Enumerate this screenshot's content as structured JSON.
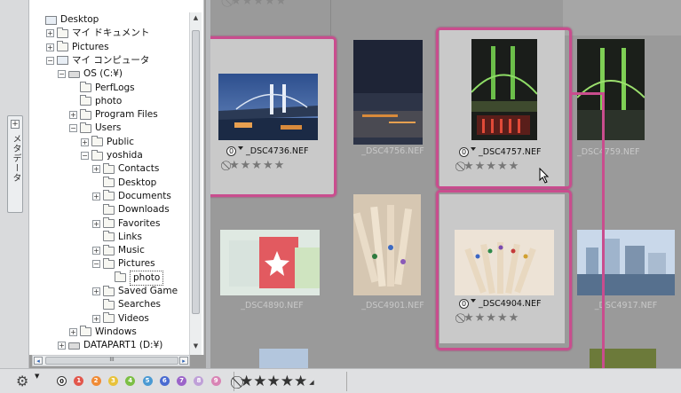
{
  "sidebar_tab": {
    "plus": "+",
    "label": "メタデータ"
  },
  "tree": {
    "expander_plus": "+",
    "expander_minus": "−",
    "items": [
      {
        "label": "Desktop",
        "indent": 0,
        "icon": "pc",
        "exp": ""
      },
      {
        "label": "マイ ドキュメント",
        "indent": 1,
        "icon": "folder",
        "exp": "+"
      },
      {
        "label": "Pictures",
        "indent": 1,
        "icon": "folder",
        "exp": "+"
      },
      {
        "label": "マイ コンピュータ",
        "indent": 1,
        "icon": "pc",
        "exp": "−"
      },
      {
        "label": "OS (C:¥)",
        "indent": 2,
        "icon": "drive",
        "exp": "−"
      },
      {
        "label": "PerfLogs",
        "indent": 3,
        "icon": "folder",
        "exp": ""
      },
      {
        "label": "photo",
        "indent": 3,
        "icon": "folder",
        "exp": ""
      },
      {
        "label": "Program Files",
        "indent": 3,
        "icon": "folder",
        "exp": "+"
      },
      {
        "label": "Users",
        "indent": 3,
        "icon": "folder",
        "exp": "−"
      },
      {
        "label": "Public",
        "indent": 4,
        "icon": "folder",
        "exp": "+"
      },
      {
        "label": "yoshida",
        "indent": 4,
        "icon": "folder",
        "exp": "−"
      },
      {
        "label": "Contacts",
        "indent": 5,
        "icon": "folder",
        "exp": "+"
      },
      {
        "label": "Desktop",
        "indent": 5,
        "icon": "folder",
        "exp": ""
      },
      {
        "label": "Documents",
        "indent": 5,
        "icon": "folder",
        "exp": "+"
      },
      {
        "label": "Downloads",
        "indent": 5,
        "icon": "folder",
        "exp": ""
      },
      {
        "label": "Favorites",
        "indent": 5,
        "icon": "folder",
        "exp": "+"
      },
      {
        "label": "Links",
        "indent": 5,
        "icon": "folder",
        "exp": ""
      },
      {
        "label": "Music",
        "indent": 5,
        "icon": "folder",
        "exp": "+"
      },
      {
        "label": "Pictures",
        "indent": 5,
        "icon": "folder",
        "exp": "−"
      },
      {
        "label": "photo",
        "indent": 6,
        "icon": "folder",
        "exp": "",
        "selected": true
      },
      {
        "label": "Saved Game",
        "indent": 5,
        "icon": "folder",
        "exp": "+"
      },
      {
        "label": "Searches",
        "indent": 5,
        "icon": "folder",
        "exp": ""
      },
      {
        "label": "Videos",
        "indent": 5,
        "icon": "folder",
        "exp": "+"
      },
      {
        "label": "Windows",
        "indent": 3,
        "icon": "folder",
        "exp": "+"
      },
      {
        "label": "DATAPART1 (D:¥)",
        "indent": 2,
        "icon": "drive",
        "exp": "+"
      }
    ],
    "hscroll_left": "◂",
    "hscroll_right": "▸",
    "hscroll_grip": "III",
    "vscroll_up": "▲",
    "vscroll_down": "▼"
  },
  "thumbnails": {
    "top_partial_rating": "⃠★★★★★",
    "no_rating_icon": "⃠",
    "stars": "★★★★★",
    "label_zero": "0",
    "files": [
      {
        "name": "_DSC4736.NEF",
        "selected": true,
        "style": "dark"
      },
      {
        "name": "_DSC4756.NEF",
        "selected": false,
        "style": "dim"
      },
      {
        "name": "_DSC4757.NEF",
        "selected": true,
        "style": "dark"
      },
      {
        "name": "_DSC4759.NEF",
        "selected": false,
        "style": "dim"
      },
      {
        "name": "_DSC4890.NEF",
        "selected": false,
        "style": "dim"
      },
      {
        "name": "_DSC4901.NEF",
        "selected": false,
        "style": "dim"
      },
      {
        "name": "_DSC4904.NEF",
        "selected": true,
        "style": "dark"
      },
      {
        "name": "_DSC4917.NEF",
        "selected": false,
        "style": "dim"
      }
    ]
  },
  "bottom_bar": {
    "label_digits": [
      "0",
      "1",
      "2",
      "3",
      "4",
      "5",
      "6",
      "7",
      "8",
      "9"
    ],
    "label_colors": [
      "#ffffff",
      "#e2574c",
      "#f08b35",
      "#e8c23a",
      "#7cbf45",
      "#4b9ad3",
      "#4a6bd1",
      "#9b64c9",
      "#bfa0d8",
      "#d984b5"
    ],
    "rating_filter": "★★★★★",
    "rating_noicon": "⃠",
    "caret": "◢"
  },
  "colors": {
    "highlight": "#c94d8e"
  }
}
